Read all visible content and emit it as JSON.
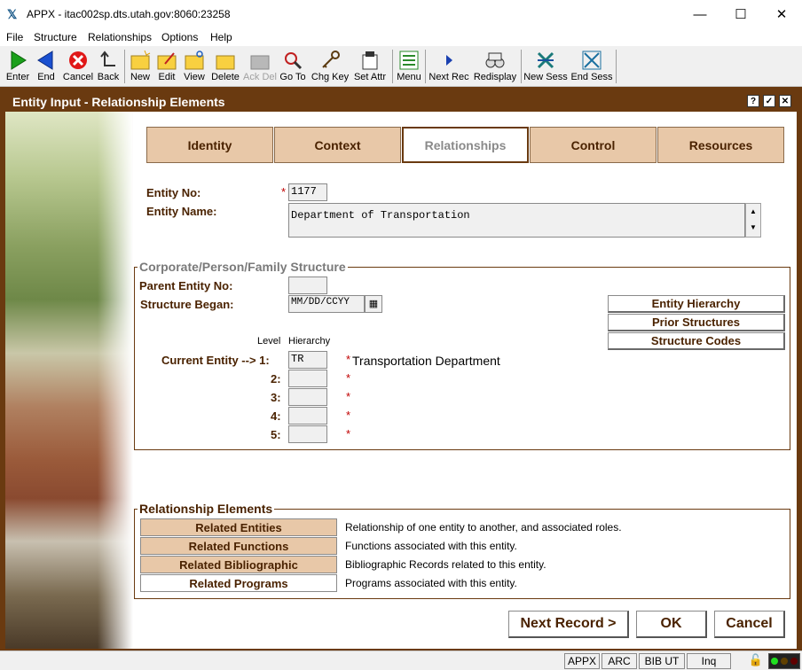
{
  "window": {
    "title": "APPX - itac002sp.dts.utah.gov:8060:23258"
  },
  "menu": [
    "File",
    "Structure",
    "Relationships",
    "Options",
    "Help"
  ],
  "toolbar": {
    "enter": "Enter",
    "end": "End",
    "cancel": "Cancel",
    "back": "Back",
    "new": "New",
    "edit": "Edit",
    "view": "View",
    "delete": "Delete",
    "ack_del": "Ack Del",
    "go_to": "Go To",
    "chg_key": "Chg Key",
    "set_attr": "Set Attr",
    "menu": "Menu",
    "next_rec": "Next Rec",
    "redisplay": "Redisplay",
    "new_sess": "New Sess",
    "end_sess": "End Sess"
  },
  "pane": {
    "title": "Entity Input - Relationship Elements",
    "help": "?",
    "ok": "✓",
    "close": "✕"
  },
  "tabs": [
    "Identity",
    "Context",
    "Relationships",
    "Control",
    "Resources"
  ],
  "entity": {
    "no_label": "Entity No:",
    "no_value": "1177",
    "name_label": "Entity Name:",
    "name_value": "Department of Transportation"
  },
  "structure": {
    "title": "Corporate/Person/Family Structure",
    "parent_label": "Parent Entity No:",
    "parent_value": "",
    "began_label": "Structure Began:",
    "began_value": "MM/DD/CCYY",
    "btn_hierarchy": "Entity Hierarchy",
    "btn_prior": "Prior Structures",
    "btn_codes": "Structure Codes",
    "level_hdr": "Level",
    "hier_hdr": "Hierarchy",
    "current_label": "Current Entity --> 1:",
    "levels": [
      "2:",
      "3:",
      "4:",
      "5:"
    ],
    "level1_value": "TR",
    "level1_desc": "Transportation Department"
  },
  "relationships": {
    "title": "Relationship Elements",
    "items": [
      {
        "label": "Related Entities",
        "desc": "Relationship of one entity to another, and associated roles."
      },
      {
        "label": "Related Functions",
        "desc": "Functions associated with this entity."
      },
      {
        "label": "Related Bibliographic",
        "desc": "Bibliographic Records related to this entity."
      },
      {
        "label": "Related Programs",
        "desc": "Programs associated with this entity."
      }
    ]
  },
  "actions": {
    "next": "Next Record >",
    "ok": "OK",
    "cancel": "Cancel"
  },
  "status": {
    "appx": "APPX",
    "arc": "ARC",
    "bib": "BIB UT",
    "mode": "Inq"
  },
  "colors": {
    "brown": "#6a3a10",
    "tan": "#e8c8a8",
    "label": "#4a2200",
    "required": "#c00000"
  }
}
